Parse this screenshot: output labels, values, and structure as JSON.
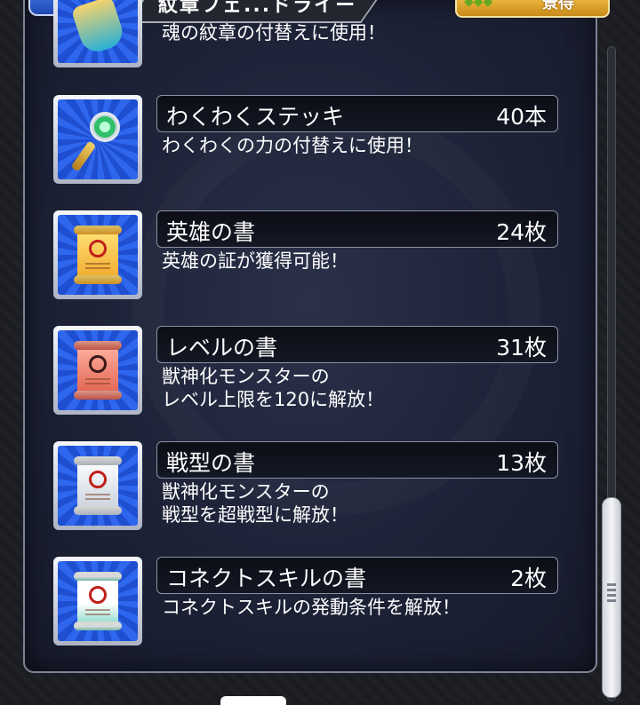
{
  "header": {
    "title": "紋章フェ...ドライー",
    "badge_label": "景得"
  },
  "items": [
    {
      "name": "",
      "count": "",
      "desc": "魂の紋章の付替えに使用！",
      "icon": "emblem-icon"
    },
    {
      "name": "わくわくステッキ",
      "count": "40本",
      "desc": "わくわくの力の付替えに使用！",
      "icon": "wand-icon"
    },
    {
      "name": "英雄の書",
      "count": "24枚",
      "desc": "英雄の証が獲得可能！",
      "icon": "hero-scroll-icon"
    },
    {
      "name": "レベルの書",
      "count": "31枚",
      "desc": "獣神化モンスターの\nレベル上限を120に解放！",
      "icon": "level-scroll-icon"
    },
    {
      "name": "戦型の書",
      "count": "13枚",
      "desc": "獣神化モンスターの\n戦型を超戦型に解放！",
      "icon": "battle-type-scroll-icon"
    },
    {
      "name": "コネクトスキルの書",
      "count": "2枚",
      "desc": "コネクトスキルの発動条件を解放！",
      "icon": "connect-skill-scroll-icon"
    }
  ],
  "colors": {
    "panel": "#1d2237",
    "frame_blue": "#2f66ee",
    "accent_gold": "#f6c54a"
  }
}
